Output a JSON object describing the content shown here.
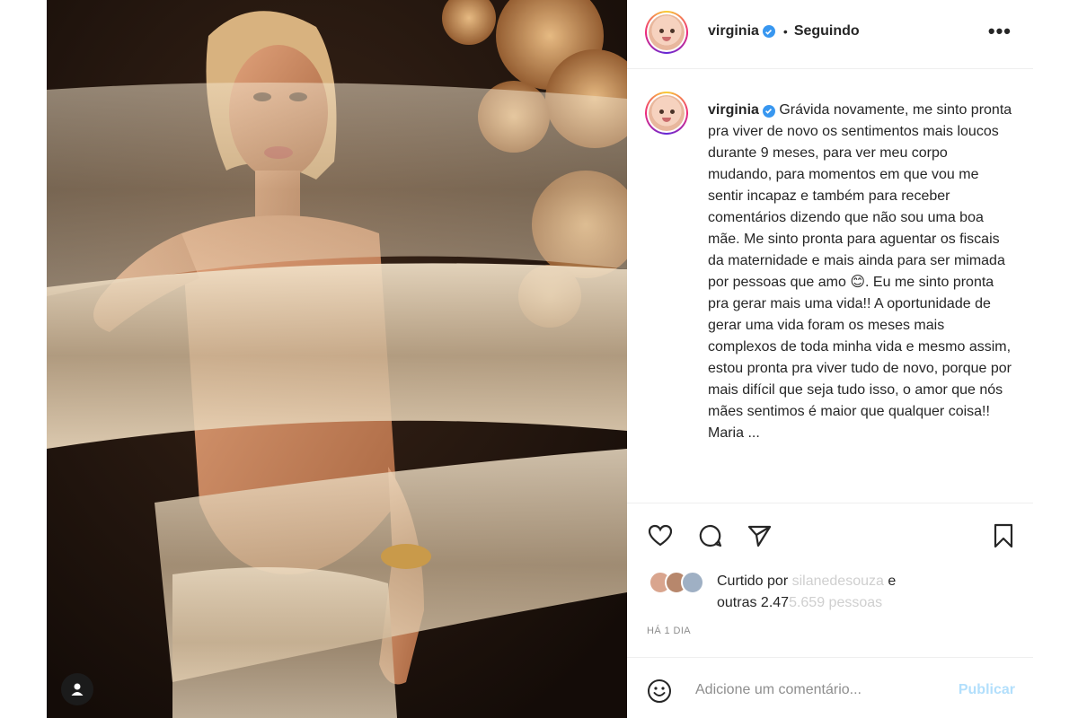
{
  "post": {
    "username": "virginia",
    "follow_separator": "•",
    "follow_status": "Seguindo",
    "more_label": "•••",
    "caption_username": "virginia",
    "caption_text": "Grávida novamente, me sinto pronta pra viver de novo os sentimentos mais loucos durante 9 meses, para ver meu corpo mudando, para momentos em que vou me sentir incapaz e também para receber comentários dizendo que não sou uma boa mãe. Me sinto pronta para aguentar os fiscais da maternidade e mais ainda para ser mimada por pessoas que amo 😊. Eu me sinto pronta pra gerar mais uma vida!! A oportunidade de gerar uma vida foram os meses mais complexos de toda minha vida e mesmo assim, estou pronta pra viver tudo de novo, porque por mais difícil que seja tudo isso, o amor que nós mães sentimos é maior que qualquer coisa!!",
    "caption_cutoff": "Maria ...",
    "likes_prefix": "Curtido por ",
    "likes_user": "silanedesouza",
    "likes_and": " e",
    "likes_others_prefix": "outras 2.47",
    "likes_others_dim": "5.659 pessoas",
    "time_ago": "HÁ 1 DIA",
    "comment_placeholder": "Adicione um comentário...",
    "publish_label": "Publicar"
  },
  "icons": {
    "like": "heart-icon",
    "comment": "comment-icon",
    "share": "paper-plane-icon",
    "save": "bookmark-icon",
    "emoji": "smiley-icon",
    "verified": "verified-badge-icon",
    "tag": "user-tag-icon"
  },
  "colors": {
    "verified_blue": "#3897f0",
    "publish_disabled": "#b2dffc",
    "secondary_text": "#8e8e8e",
    "border": "#efefef"
  }
}
